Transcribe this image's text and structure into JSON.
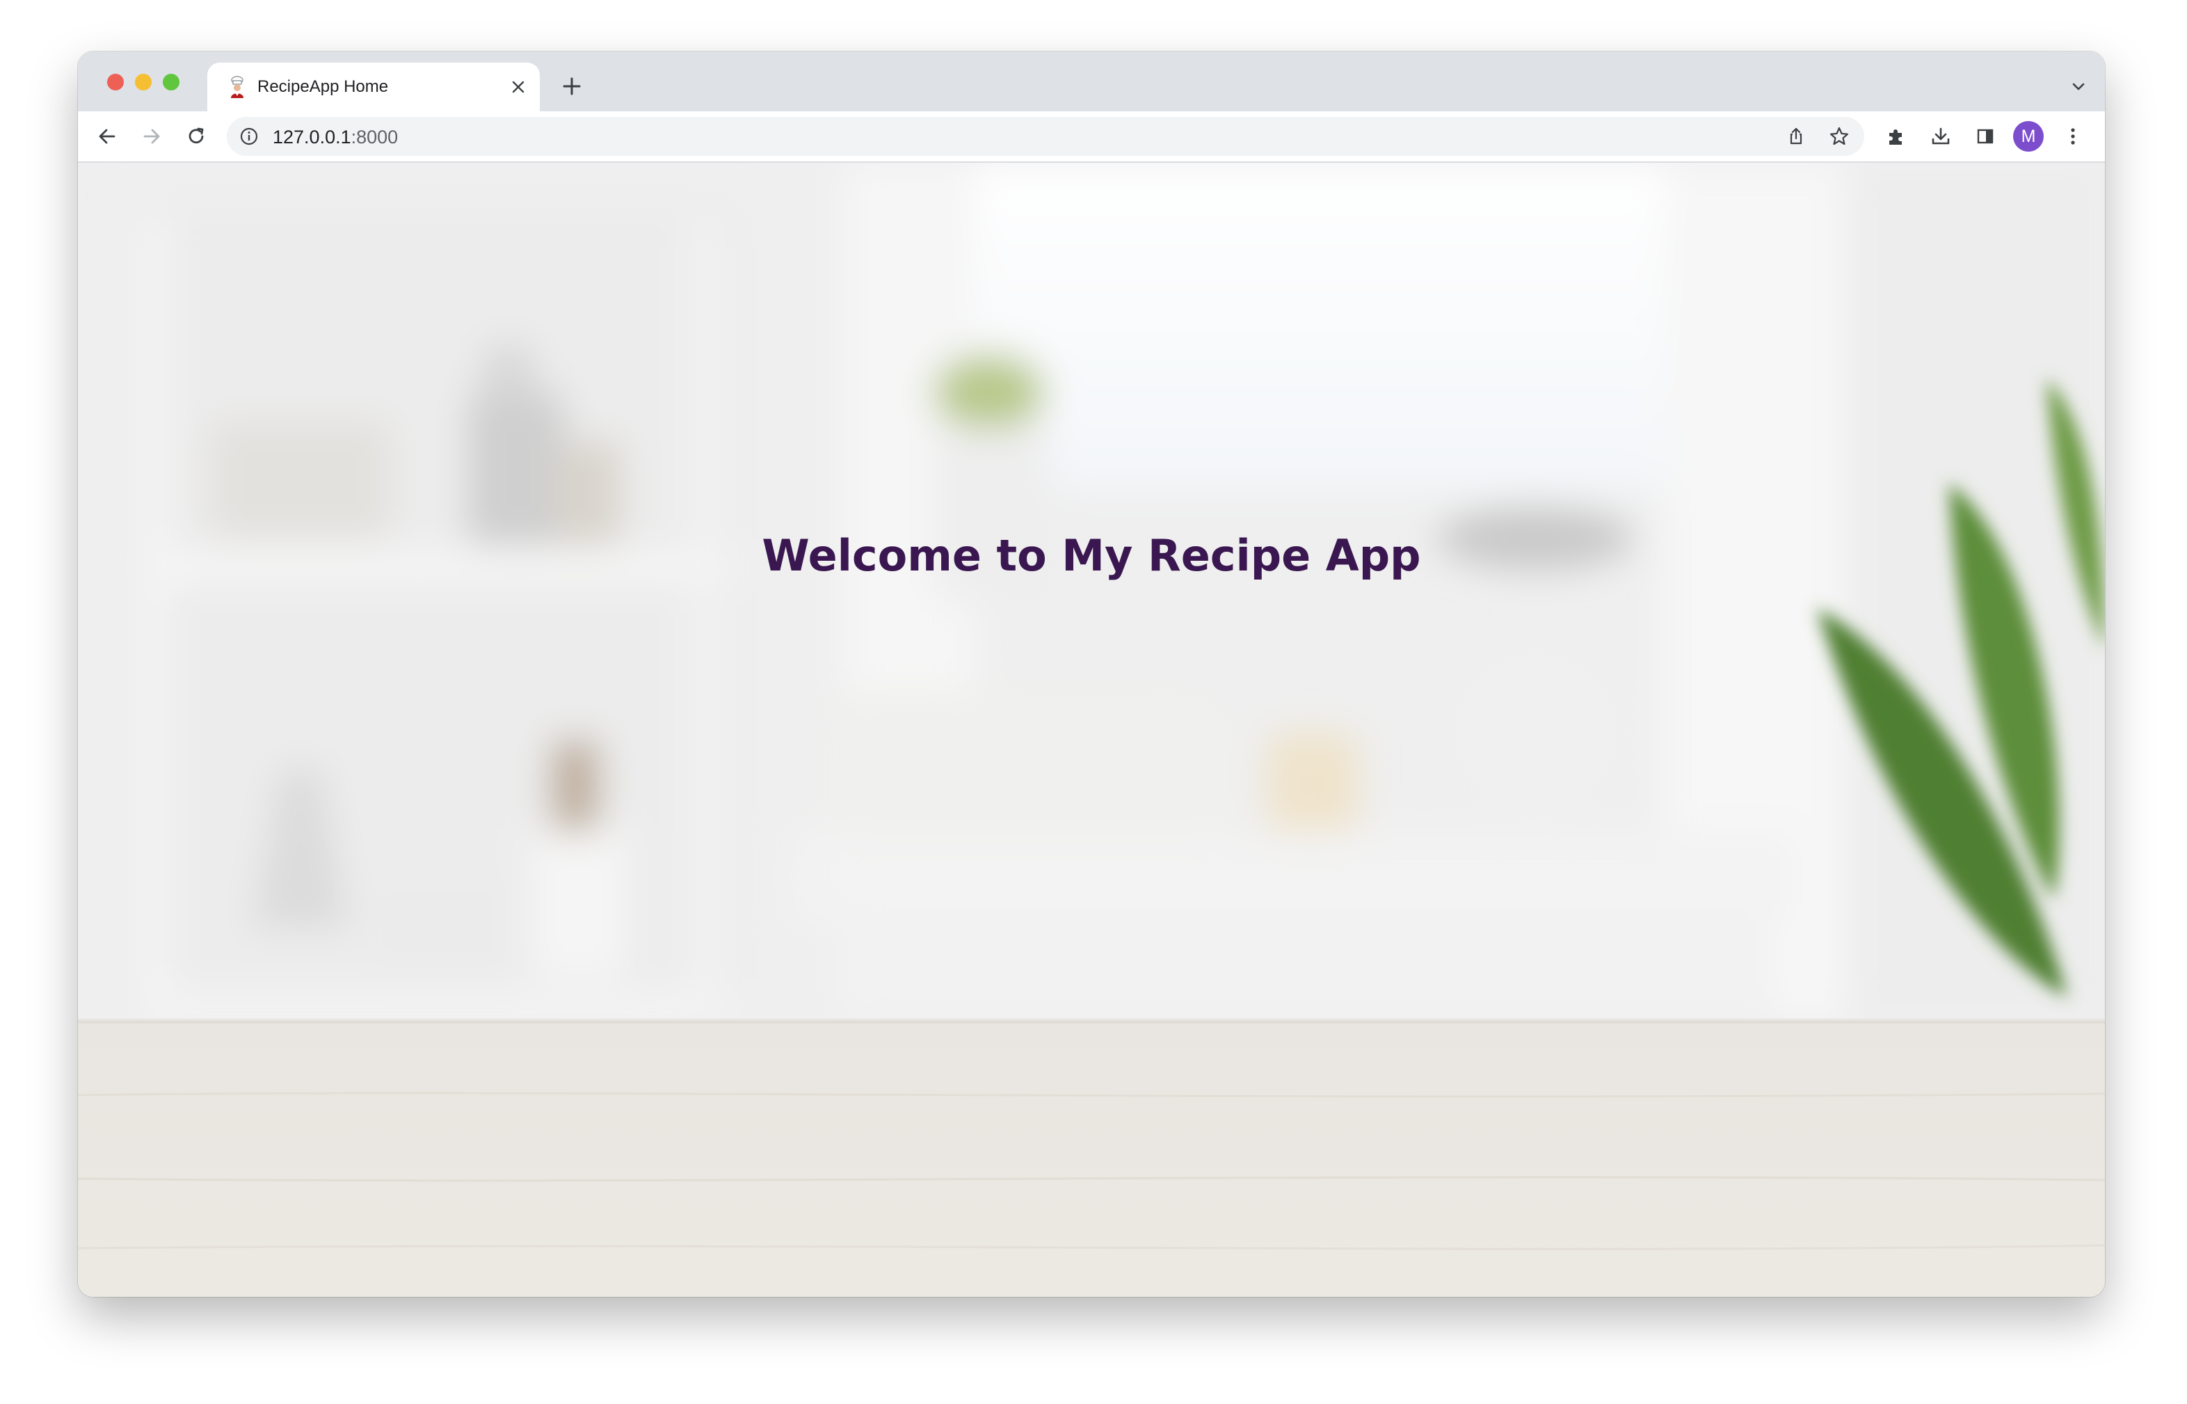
{
  "browser": {
    "tab": {
      "title": "RecipeApp Home"
    },
    "address_bar": {
      "host": "127.0.0.1",
      "port": ":8000"
    },
    "profile": {
      "initial": "M",
      "color": "#7c4dcc"
    },
    "icons": {
      "back": "back-arrow-icon",
      "forward": "forward-arrow-icon",
      "reload": "reload-icon",
      "site_info": "info-icon",
      "share": "share-icon",
      "bookmark": "star-icon",
      "extensions": "puzzle-icon",
      "downloads": "download-icon",
      "side_panel": "side-panel-icon",
      "menu": "kebab-menu-icon"
    }
  },
  "page": {
    "heading": "Welcome to My Recipe App",
    "heading_color": "#3a1750"
  }
}
